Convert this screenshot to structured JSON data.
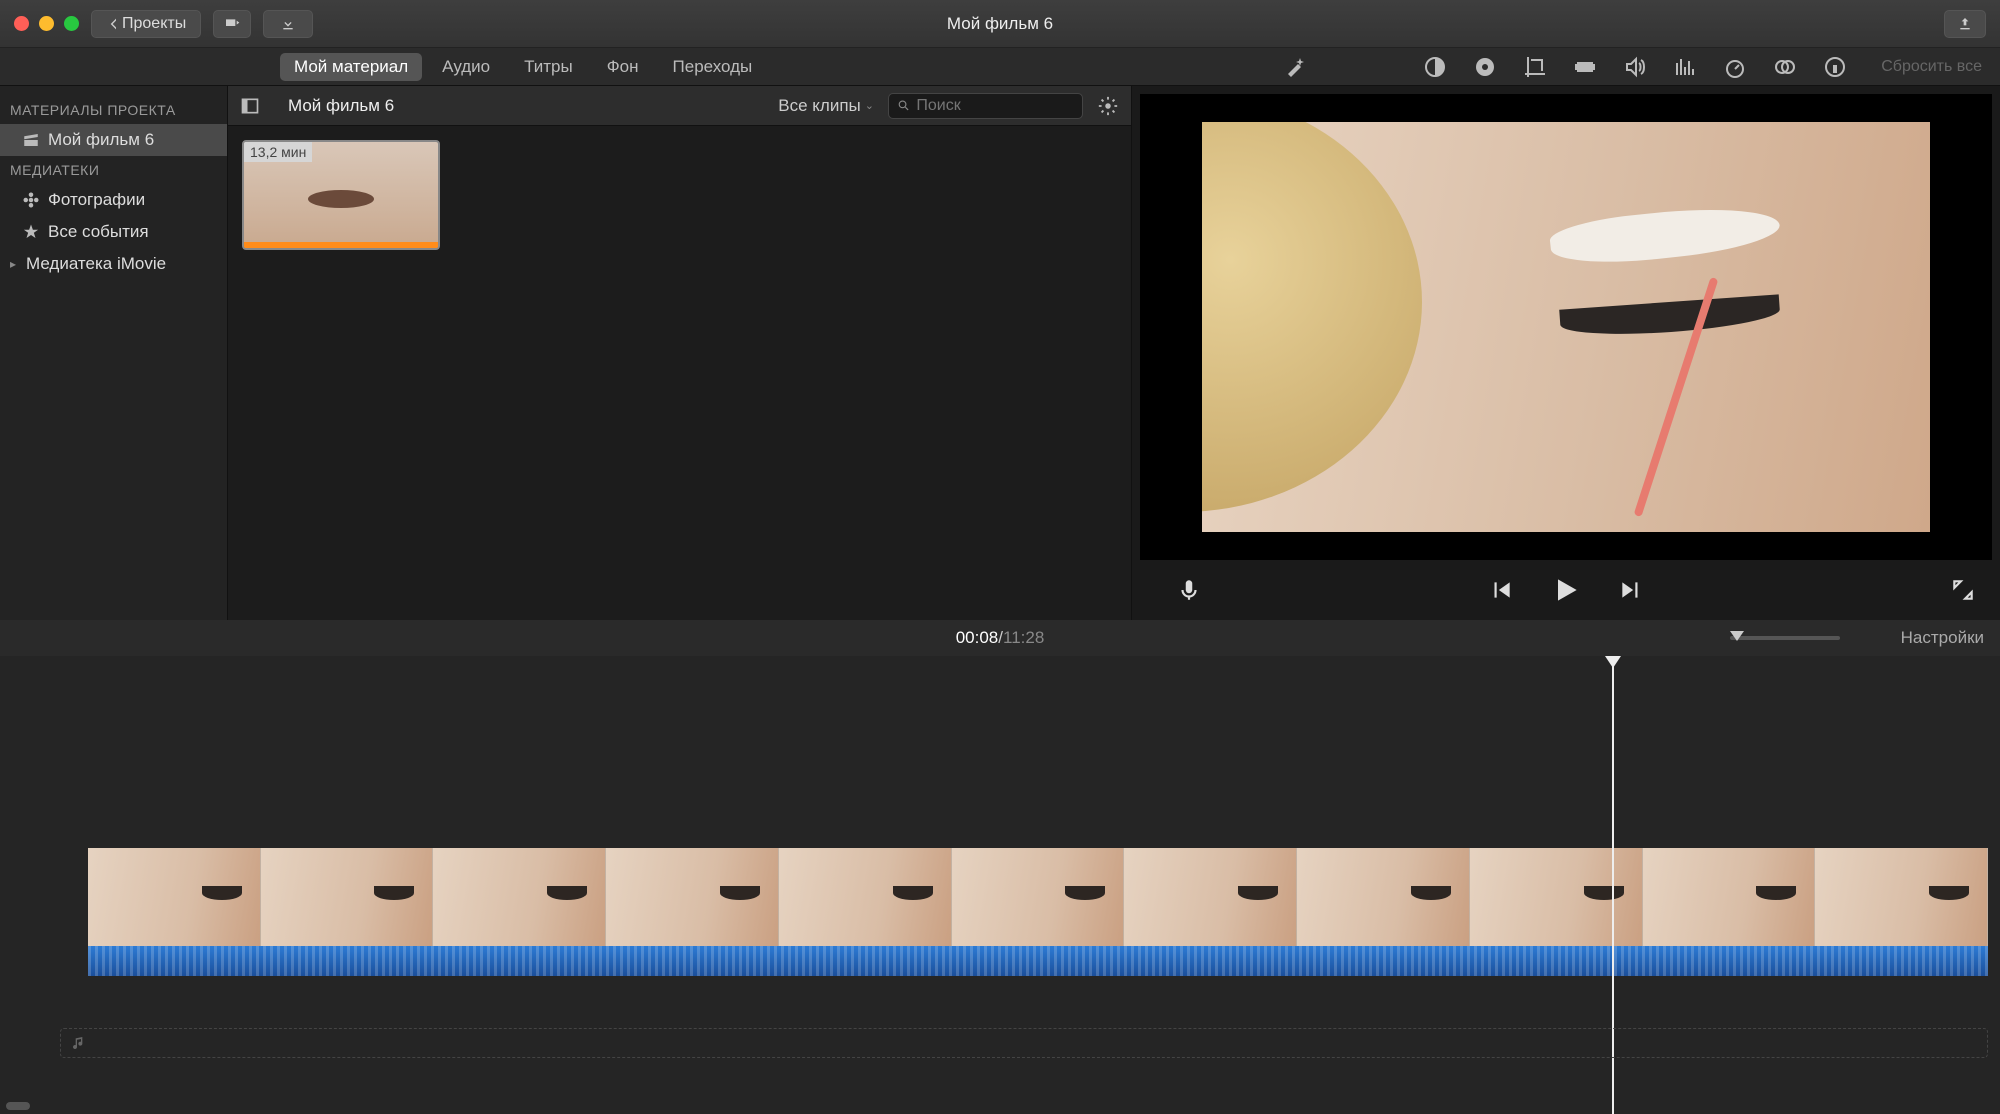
{
  "titlebar": {
    "projects_label": "Проекты",
    "app_title": "Мой фильм 6"
  },
  "tabs": {
    "items": [
      {
        "label": "Мой материал",
        "active": true
      },
      {
        "label": "Аудио",
        "active": false
      },
      {
        "label": "Титры",
        "active": false
      },
      {
        "label": "Фон",
        "active": false
      },
      {
        "label": "Переходы",
        "active": false
      }
    ],
    "reset_label": "Сбросить все"
  },
  "sidebar": {
    "section1_label": "МАТЕРИАЛЫ ПРОЕКТА",
    "project_name": "Мой фильм 6",
    "section2_label": "МЕДИАТЕКИ",
    "items": [
      {
        "label": "Фотографии"
      },
      {
        "label": "Все события"
      },
      {
        "label": "Медиатека iMovie"
      }
    ]
  },
  "browser": {
    "crumb": "Мой фильм 6",
    "filter_label": "Все клипы",
    "search_placeholder": "Поиск",
    "clip_duration": "13,2 мин"
  },
  "timeline_head": {
    "current": "00:08",
    "sep": " / ",
    "total": "11:28",
    "settings_label": "Настройки"
  },
  "icons": {
    "wand": "wand-icon",
    "color_balance": "color-balance-icon",
    "color_wheel": "color-wheel-icon",
    "crop": "crop-icon",
    "stabilize": "stabilize-icon",
    "volume": "volume-icon",
    "eq": "eq-icon",
    "noise": "noise-icon",
    "filter": "filter-icon",
    "info": "info-icon"
  }
}
